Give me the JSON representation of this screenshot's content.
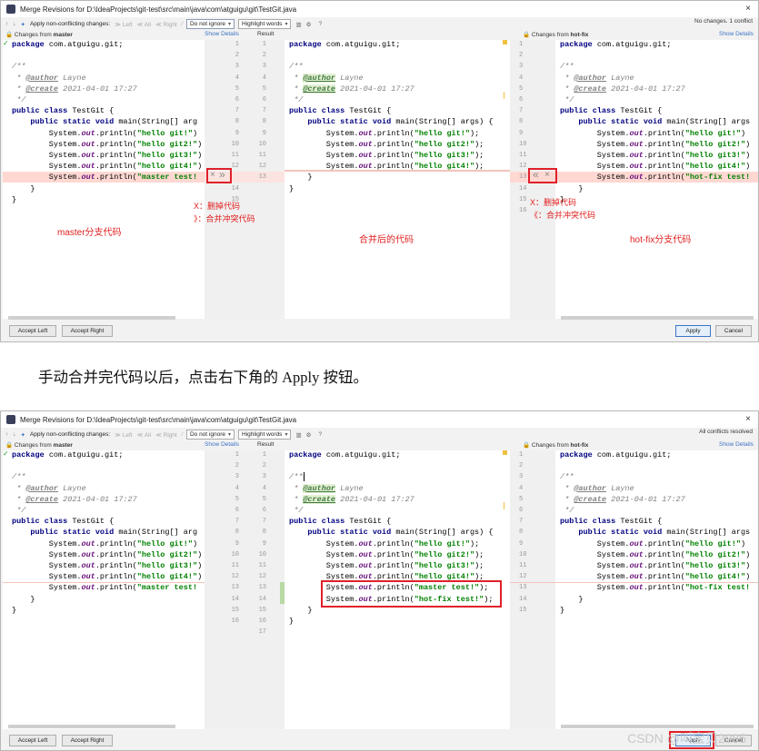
{
  "window1": {
    "title": "Merge Revisions for D:\\IdeaProjects\\git-test\\src\\main\\java\\com\\atguigu\\git\\TestGit.java",
    "close": "×",
    "toolbar": {
      "up": "↑",
      "down": "↓",
      "apply_nc": "Apply non-conflicting changes:",
      "left": "≫ Left",
      "all": "≪ All",
      "right": "≪ Right",
      "ignore": "Do not ignore",
      "highlight": "Highlight words",
      "help": "?"
    },
    "status": "No changes. 1 conflict",
    "left_header_prefix": "Changes from ",
    "left_header_branch": "master",
    "right_header_prefix": "Changes from ",
    "right_header_branch": "hot-fix",
    "show_details": "Show Details",
    "result_header": "Result",
    "accept_left": "Accept Left",
    "accept_right": "Accept Right",
    "apply": "Apply",
    "cancel": "Cancel"
  },
  "window2": {
    "title": "Merge Revisions for D:\\IdeaProjects\\git-test\\src\\main\\java\\com\\atguigu\\git\\TestGit.java",
    "close": "×",
    "toolbar": {
      "up": "↑",
      "down": "↓",
      "apply_nc": "Apply non-conflicting changes:",
      "left": "≫ Left",
      "all": "≪ All",
      "right": "≪ Right",
      "ignore": "Do not ignore",
      "highlight": "Highlight words",
      "help": "?"
    },
    "status": "All conflicts resolved",
    "left_header_prefix": "Changes from ",
    "left_header_branch": "master",
    "right_header_prefix": "Changes from ",
    "right_header_branch": "hot-fix",
    "show_details": "Show Details",
    "result_header": "Result",
    "accept_left": "Accept Left",
    "accept_right": "Accept Right",
    "apply": "Apply",
    "cancel": "Cancel"
  },
  "code": {
    "pkg": "package com.atguigu.git;",
    "c1": "/**",
    "author_tag": "@author",
    "author_val": " Layne",
    "create_tag": "@create",
    "create_val": " 2021-04-01 17:27",
    "c4": " */",
    "cls": "public class TestGit {",
    "main_full": "    public static void main(String[] args) {",
    "main_cut": "    public static void main(String[] arg",
    "p1": "\"hello git!\"",
    "p2": "\"hello git2!\"",
    "p3": "\"hello git3!\"",
    "p4": "\"hello git4!\"",
    "master": "\"master test!",
    "master_full": "\"master test!\"",
    "hotfix": "\"hot-fix test!",
    "hotfix_full": "\"hot-fix test!\"",
    "close_inner": "    }",
    "close_outer": "}"
  },
  "annotations": {
    "x_del": "X：删掉代码",
    "merge_left": "》：合并冲突代码",
    "merge_right": "《：合并冲突代码",
    "master_label": "master分支代码",
    "merged_label": "合并后的代码",
    "hotfix_label": "hot-fix分支代码",
    "x_icon": "×",
    "merge_icon_left": "»",
    "merge_icon_right": "«"
  },
  "caption": "手动合并完代码以后，点击右下角的 Apply 按钮。",
  "watermark": "CSDN @叫宝贝2085"
}
